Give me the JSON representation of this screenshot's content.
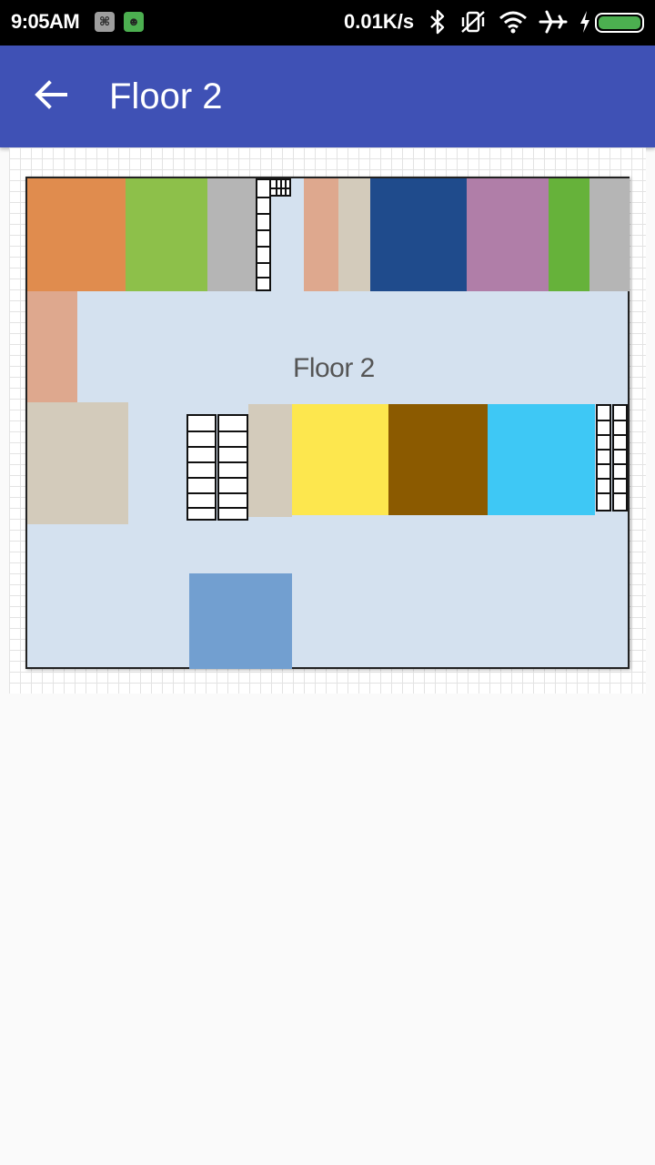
{
  "status_bar": {
    "time": "9:05AM",
    "speed": "0.01K/s",
    "icons": [
      "notification-app-icon",
      "notification-game-icon",
      "bluetooth-icon",
      "vibrate-off-icon",
      "wifi-icon",
      "airplane-icon",
      "charging-icon",
      "battery-icon"
    ],
    "battery_level": 1.0,
    "battery_color": "#4caf50"
  },
  "app_bar": {
    "title": "Floor 2",
    "back_icon": "arrow-back-icon",
    "color": "#3f51b5"
  },
  "map": {
    "label": "Floor 2",
    "corridor_color": "#d4e1ef",
    "room_colors": [
      "#e08c4e",
      "#8dc04a",
      "#b5b5b5",
      "#dea88e",
      "#d3cbbb",
      "#1f4b8c",
      "#b07ea8",
      "#66b23a",
      "#fde74e",
      "#8b5a00",
      "#3ec8f5",
      "#729fd0"
    ]
  }
}
